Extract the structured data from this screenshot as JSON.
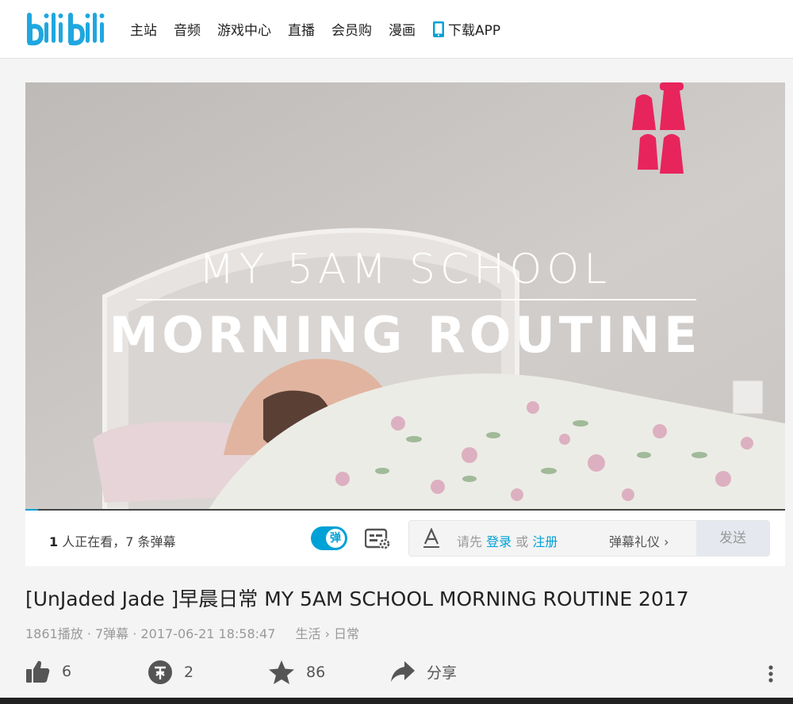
{
  "header": {
    "logo_text": "bilibili",
    "nav": [
      "主站",
      "音频",
      "游戏中心",
      "直播",
      "会员购",
      "漫画"
    ],
    "download_label": "下载APP"
  },
  "video": {
    "title_line1": "MY 5AM SCHOOL",
    "title_line2": "MORNING ROUTINE",
    "progress": 0.017
  },
  "controls": {
    "viewers_count": "1",
    "viewers_text": "人正在看，7 条弹幕",
    "danmaku_toggle_label": "弹",
    "input_tip_prefix": "请先",
    "login_label": "登录",
    "or_label": "或",
    "register_label": "注册",
    "etiquette_label": "弹幕礼仪 ›",
    "send_label": "发送"
  },
  "info": {
    "title": "[UnJaded Jade ]早晨日常 MY 5AM SCHOOL MORNING ROUTINE 2017",
    "plays": "1861播放",
    "danmaku": "7弹幕",
    "date": "2017-06-21 18:58:47",
    "category": "生活 › 日常"
  },
  "actions": {
    "like": "6",
    "coin": "2",
    "favorite": "86",
    "share": "分享"
  },
  "colors": {
    "accent": "#00a1d6",
    "tassel": "#e8245c"
  }
}
